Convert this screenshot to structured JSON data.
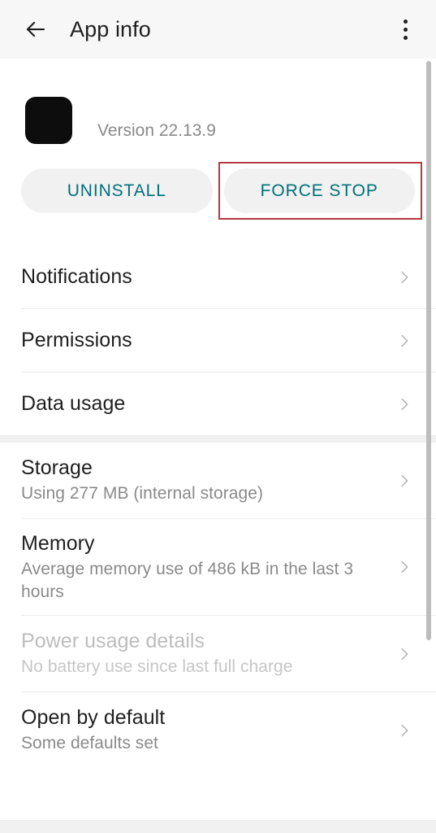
{
  "appbar": {
    "back_icon": "arrow-back-icon",
    "title": "App info",
    "overflow_icon": "more-vert-icon"
  },
  "app_header": {
    "icon": "app-icon",
    "name": "",
    "version": "Version 22.13.9"
  },
  "actions": {
    "uninstall_label": "UNINSTALL",
    "force_stop_label": "FORCE STOP",
    "highlight_color": "#b33a43",
    "accent_color": "#00707a",
    "button_bg": "#f1f1f1"
  },
  "sections": [
    {
      "rows": [
        {
          "title": "Notifications",
          "summary": "",
          "disabled": false,
          "chevron": "chevron-right-icon"
        },
        {
          "title": "Permissions",
          "summary": "",
          "disabled": false,
          "chevron": "chevron-right-icon"
        },
        {
          "title": "Data usage",
          "summary": "",
          "disabled": false,
          "chevron": "chevron-right-icon"
        }
      ]
    },
    {
      "rows": [
        {
          "title": "Storage",
          "summary": "Using 277 MB (internal storage)",
          "disabled": false,
          "chevron": "chevron-right-icon"
        },
        {
          "title": "Memory",
          "summary": "Average memory use of 486 kB in the last 3 hours",
          "disabled": false,
          "chevron": "chevron-right-icon"
        },
        {
          "title": "Power usage details",
          "summary": "No battery use since last full charge",
          "disabled": true,
          "chevron": "chevron-right-icon"
        },
        {
          "title": "Open by default",
          "summary": "Some defaults set",
          "disabled": false,
          "chevron": "chevron-right-icon"
        }
      ]
    }
  ],
  "scrollbar": {
    "visible": true,
    "color": "#bdbdbd"
  }
}
